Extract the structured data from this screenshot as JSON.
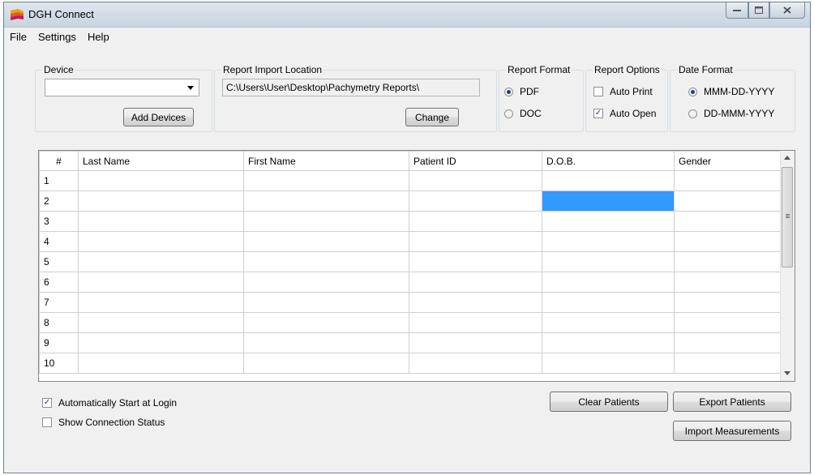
{
  "window": {
    "title": "DGH Connect"
  },
  "menu": [
    "File",
    "Settings",
    "Help"
  ],
  "device": {
    "group_label": "Device",
    "selected_value": "",
    "add_button": "Add Devices"
  },
  "report_location": {
    "group_label": "Report Import Location",
    "path": "C:\\Users\\User\\Desktop\\Pachymetry Reports\\",
    "change_button": "Change"
  },
  "report_format": {
    "group_label": "Report Format",
    "options": [
      {
        "label": "PDF",
        "selected": true
      },
      {
        "label": "DOC",
        "selected": false
      }
    ]
  },
  "report_options": {
    "group_label": "Report Options",
    "options": [
      {
        "label": "Auto Print",
        "checked": false
      },
      {
        "label": "Auto Open",
        "checked": true
      }
    ]
  },
  "date_format": {
    "group_label": "Date Format",
    "options": [
      {
        "label": "MMM-DD-YYYY",
        "selected": true
      },
      {
        "label": "DD-MMM-YYYY",
        "selected": false
      }
    ]
  },
  "grid": {
    "columns": [
      "#",
      "Last Name",
      "First Name",
      "Patient ID",
      "D.O.B.",
      "Gender"
    ],
    "rows": [
      "1",
      "2",
      "3",
      "4",
      "5",
      "6",
      "7",
      "8",
      "9",
      "10"
    ],
    "selected_cell": {
      "row": 2,
      "column": "D.O.B."
    }
  },
  "bottom": {
    "auto_start": {
      "label": "Automatically Start at Login",
      "checked": true
    },
    "show_status": {
      "label": "Show Connection Status",
      "checked": false
    },
    "clear_button": "Clear Patients",
    "export_button": "Export Patients",
    "import_button": "Import Measurements"
  },
  "colors": {
    "selection": "#3399ff",
    "window_bg": "#f0f0f0"
  }
}
